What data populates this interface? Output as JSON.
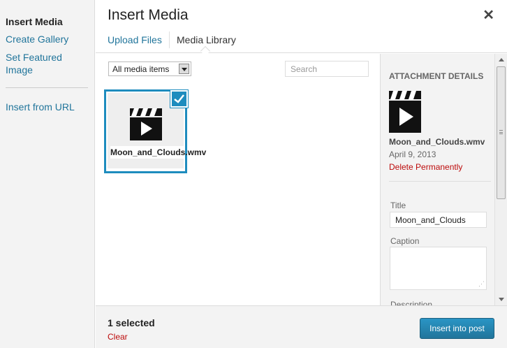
{
  "menu": {
    "items": [
      {
        "label": "Insert Media",
        "active": true
      },
      {
        "label": "Create Gallery"
      },
      {
        "label": "Set Featured Image"
      },
      {
        "label": "Insert from URL"
      }
    ]
  },
  "frame": {
    "title": "Insert Media",
    "close_icon": "close-icon",
    "tabs": [
      "Upload Files",
      "Media Library"
    ]
  },
  "toolbar": {
    "filter_value": "All media items",
    "search_placeholder": "Search"
  },
  "attachment": {
    "filename": "Moon_and_Clouds.wmv",
    "icon": "video-icon",
    "selected": true
  },
  "details": {
    "heading": "ATTACHMENT DETAILS",
    "filename": "Moon_and_Clouds.wmv",
    "date": "April 9, 2013",
    "delete_label": "Delete Permanently",
    "title_label": "Title",
    "title_value": "Moon_and_Clouds",
    "caption_label": "Caption",
    "description_label": "Description"
  },
  "footer": {
    "selected_text": "1 selected",
    "clear_label": "Clear",
    "insert_label": "Insert into post"
  },
  "colors": {
    "link": "#21759b",
    "accent": "#1e8cbe",
    "delete": "#bc0b0b"
  }
}
